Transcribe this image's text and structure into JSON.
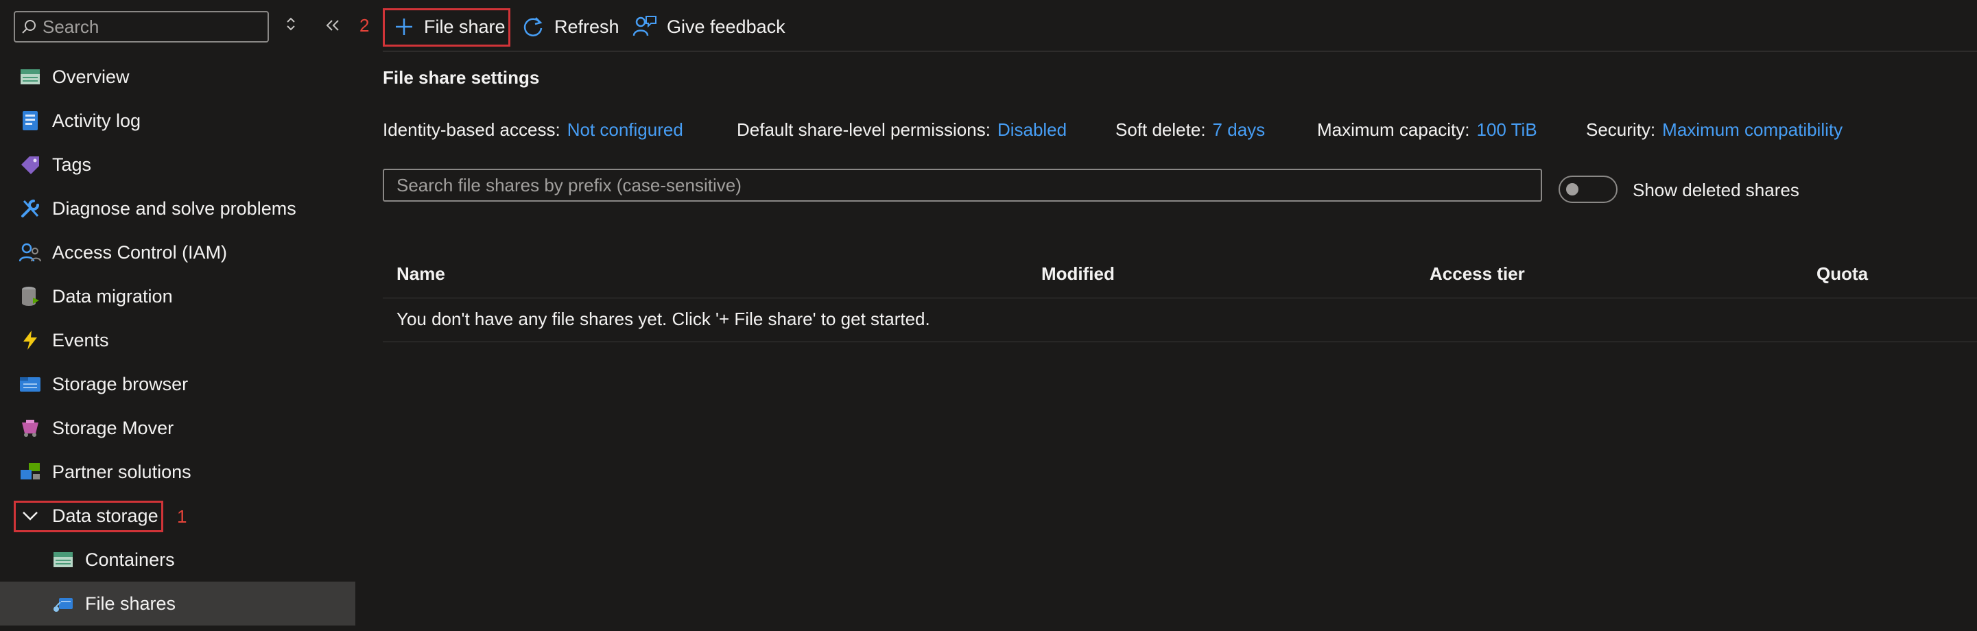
{
  "sidebar": {
    "search": {
      "placeholder": "Search"
    },
    "expand_icon": "up-down-chevron-icon",
    "collapse_icon": "double-chevron-left-icon",
    "items": [
      {
        "label": "Overview",
        "icon": "overview-icon"
      },
      {
        "label": "Activity log",
        "icon": "activity-log-icon"
      },
      {
        "label": "Tags",
        "icon": "tag-icon"
      },
      {
        "label": "Diagnose and solve problems",
        "icon": "wrench-icon"
      },
      {
        "label": "Access Control (IAM)",
        "icon": "people-icon"
      },
      {
        "label": "Data migration",
        "icon": "data-migration-icon"
      },
      {
        "label": "Events",
        "icon": "lightning-icon"
      },
      {
        "label": "Storage browser",
        "icon": "storage-browser-icon"
      },
      {
        "label": "Storage Mover",
        "icon": "storage-mover-icon"
      },
      {
        "label": "Partner solutions",
        "icon": "partner-solutions-icon"
      },
      {
        "label": "Data storage",
        "icon": "chevron-down-icon",
        "annotation": "1"
      },
      {
        "label": "Containers",
        "icon": "containers-icon"
      },
      {
        "label": "File shares",
        "icon": "file-shares-icon",
        "active": true
      }
    ]
  },
  "toolbar": {
    "annotation": "2",
    "add_file_share": "File share",
    "refresh": "Refresh",
    "feedback": "Give feedback"
  },
  "settings": {
    "title": "File share settings",
    "identity_label": "Identity-based access:",
    "identity_value": "Not configured",
    "permissions_label": "Default share-level permissions:",
    "permissions_value": "Disabled",
    "soft_delete_label": "Soft delete:",
    "soft_delete_value": "7 days",
    "capacity_label": "Maximum capacity:",
    "capacity_value": "100 TiB",
    "security_label": "Security:",
    "security_value": "Maximum compatibility"
  },
  "filter": {
    "placeholder": "Search file shares by prefix (case-sensitive)",
    "toggle_label": "Show deleted shares"
  },
  "table": {
    "columns": [
      "Name",
      "Modified",
      "Access tier",
      "Quota"
    ],
    "empty_message": "You don't have any file shares yet. Click '+ File share' to get started."
  },
  "colors": {
    "accent": "#479ef5",
    "annotation": "#d13438",
    "background": "#1b1a19"
  }
}
